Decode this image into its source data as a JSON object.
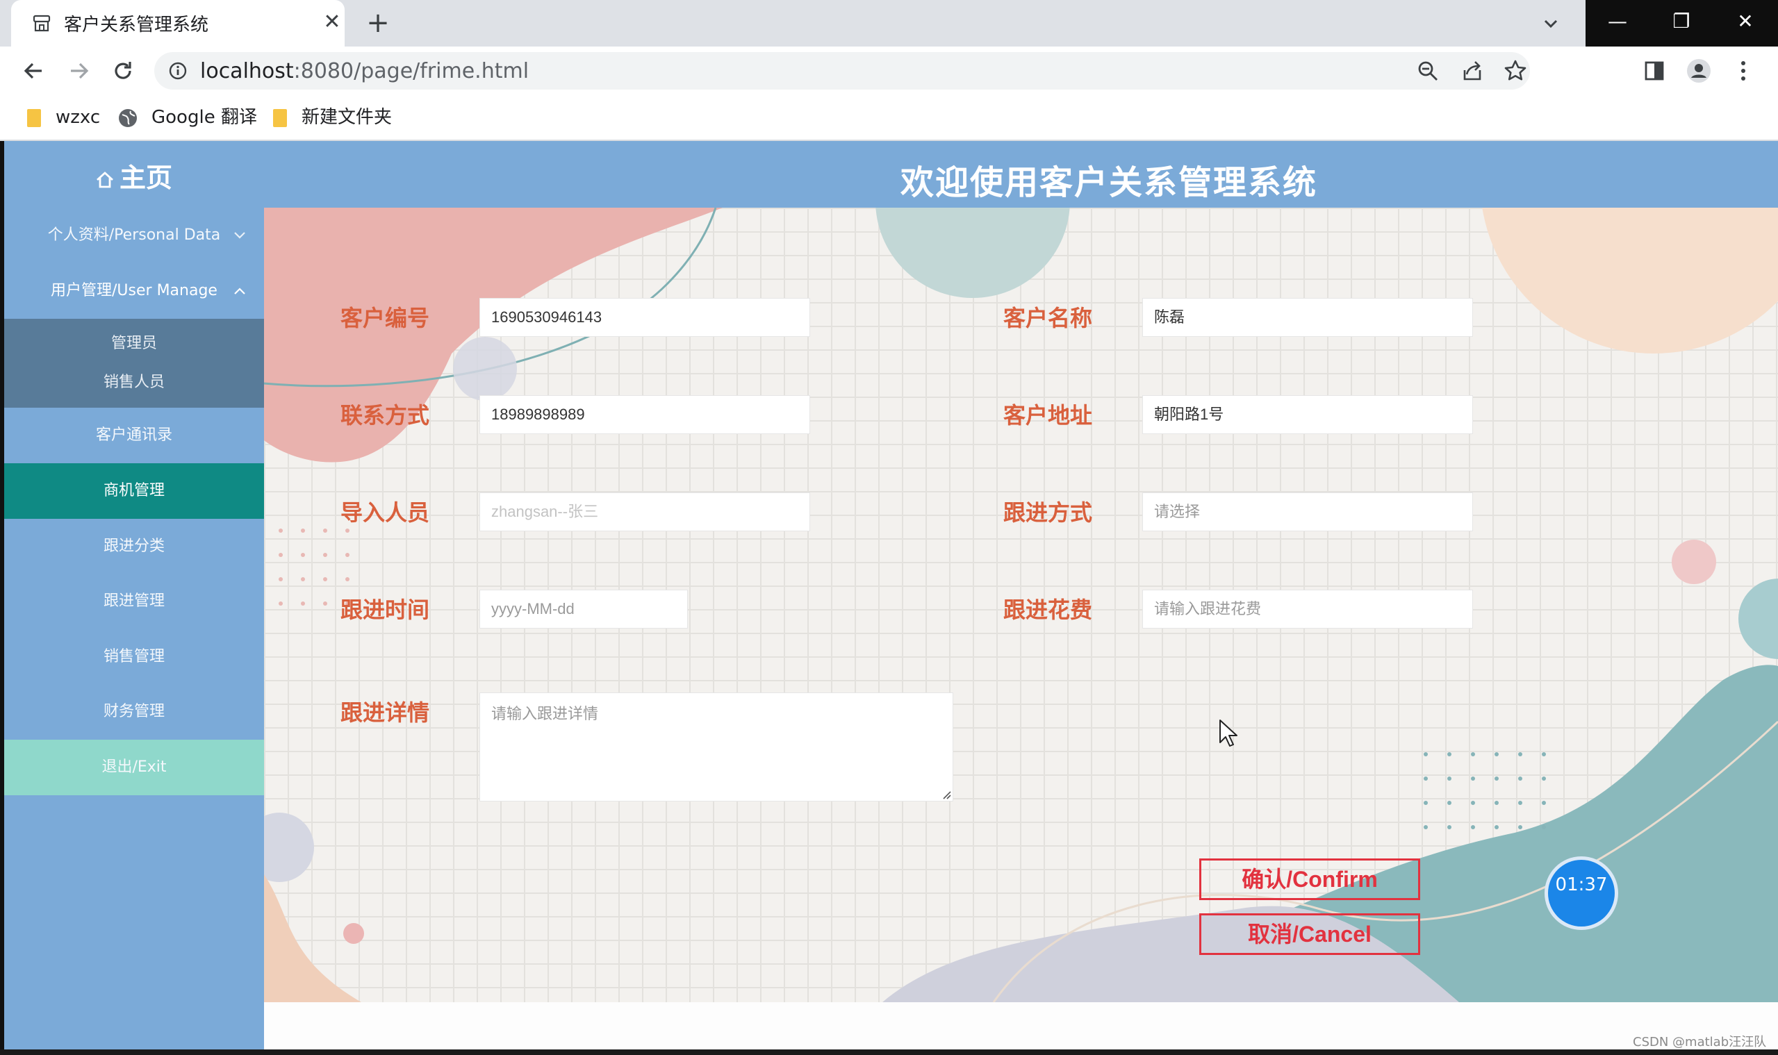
{
  "browser": {
    "tab_title": "客户关系管理系统",
    "tab_close": "✕",
    "new_tab": "+",
    "url_host": "localhost",
    "url_path": ":8080/page/frime.html",
    "bookmarks": [
      "wzxc",
      "Google 翻译",
      "新建文件夹"
    ],
    "window_controls": [
      "—",
      "❐",
      "✕"
    ]
  },
  "header": {
    "home_label": "主页",
    "title": "欢迎使用客户关系管理系统"
  },
  "sidebar": {
    "personal": "个人资料/Personal Data",
    "user_manage": "用户管理/User Manage",
    "sub_items": [
      "管理员",
      "销售人员"
    ],
    "items": [
      "客户通讯录",
      "商机管理",
      "跟进分类",
      "跟进管理",
      "销售管理",
      "财务管理",
      "退出/Exit"
    ],
    "active_item": "商机管理"
  },
  "form": {
    "customer_id_label": "客户编号",
    "customer_id_value": "1690530946143",
    "customer_name_label": "客户名称",
    "customer_name_value": "陈磊",
    "contact_label": "联系方式",
    "contact_value": "18989898989",
    "address_label": "客户地址",
    "address_value": "朝阳路1号",
    "importer_label": "导入人员",
    "importer_placeholder": "zhangsan--张三",
    "method_label": "跟进方式",
    "method_placeholder": "请选择",
    "time_label": "跟进时间",
    "time_placeholder": "yyyy-MM-dd",
    "cost_label": "跟进花费",
    "cost_placeholder": "请输入跟进花费",
    "detail_label": "跟进详情",
    "detail_placeholder": "请输入跟进详情",
    "confirm": "确认/Confirm",
    "cancel": "取消/Cancel"
  },
  "overlay": {
    "timer": "01:37",
    "watermark": "CSDN @matlab汪汪队"
  },
  "colors": {
    "header": "#7baad8",
    "sidebar": "#7baad8",
    "active_item": "#0f8a84",
    "exit_item": "#8fd8cb",
    "label": "#d9603d",
    "button": "#e2323f"
  }
}
